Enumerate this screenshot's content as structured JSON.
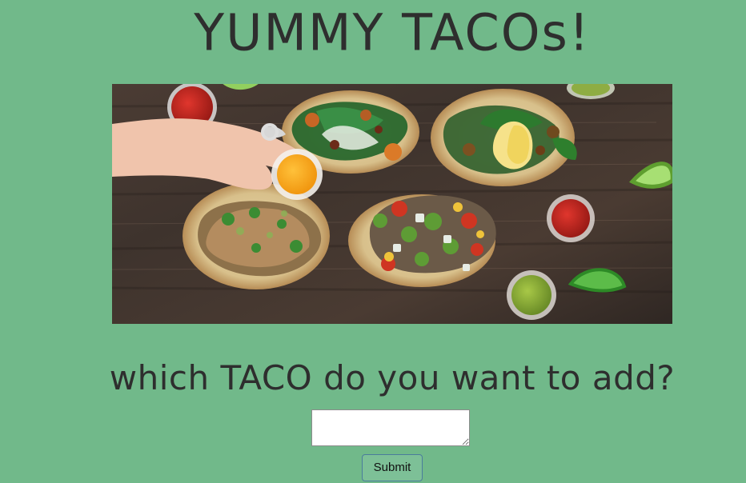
{
  "page": {
    "title": "YUMMY TACOs!",
    "question": "which TACO do you want to add?",
    "submit_label": "Submit"
  },
  "colors": {
    "background": "#71b98a",
    "text": "#2e2e2e"
  }
}
